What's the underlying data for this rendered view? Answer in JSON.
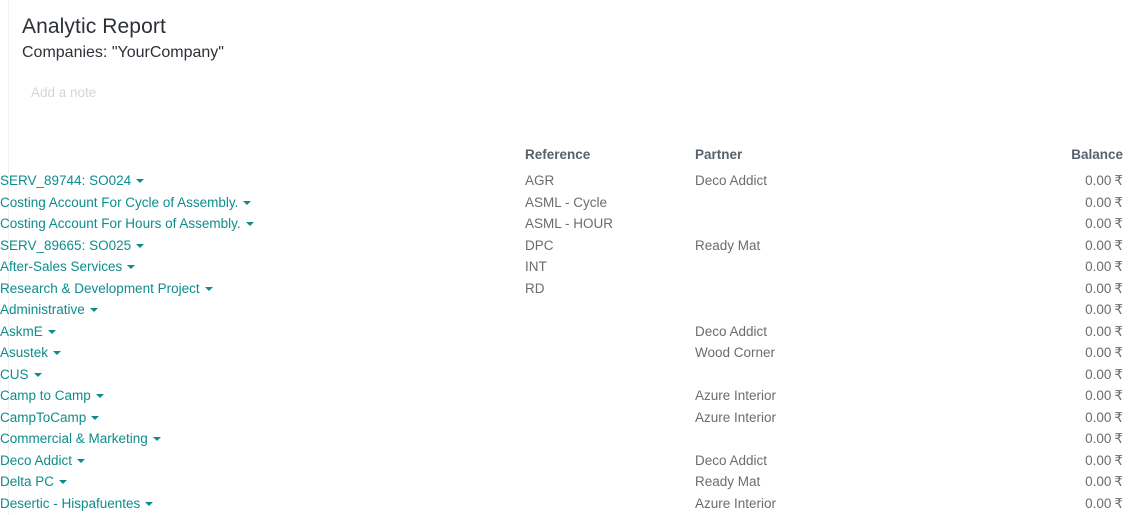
{
  "report": {
    "title": "Analytic Report",
    "subtitle": "Companies: \"YourCompany\"",
    "note_placeholder": "Add a note"
  },
  "colors": {
    "link_teal": "#0e8c8c",
    "header_gray": "#58626d",
    "body_gray": "#6c6c6c",
    "title_dark": "#2c3137",
    "placeholder_gray": "#d5d5d5"
  },
  "table": {
    "columns": {
      "name": "",
      "reference": "Reference",
      "partner": "Partner",
      "balance": "Balance"
    },
    "currency_symbol": "₹",
    "rows": [
      {
        "name": "SERV_89744: SO024",
        "reference": "AGR",
        "partner": "Deco Addict",
        "balance": "0.00"
      },
      {
        "name": "Costing Account For Cycle of Assembly.",
        "reference": "ASML - Cycle",
        "partner": "",
        "balance": "0.00"
      },
      {
        "name": "Costing Account For Hours of Assembly.",
        "reference": "ASML - HOUR",
        "partner": "",
        "balance": "0.00"
      },
      {
        "name": "SERV_89665: SO025",
        "reference": "DPC",
        "partner": "Ready Mat",
        "balance": "0.00"
      },
      {
        "name": "After-Sales Services",
        "reference": "INT",
        "partner": "",
        "balance": "0.00"
      },
      {
        "name": "Research & Development Project",
        "reference": "RD",
        "partner": "",
        "balance": "0.00"
      },
      {
        "name": "Administrative",
        "reference": "",
        "partner": "",
        "balance": "0.00"
      },
      {
        "name": "AskmE",
        "reference": "",
        "partner": "Deco Addict",
        "balance": "0.00"
      },
      {
        "name": "Asustek",
        "reference": "",
        "partner": "Wood Corner",
        "balance": "0.00"
      },
      {
        "name": "CUS",
        "reference": "",
        "partner": "",
        "balance": "0.00"
      },
      {
        "name": "Camp to Camp",
        "reference": "",
        "partner": "Azure Interior",
        "balance": "0.00"
      },
      {
        "name": "CampToCamp",
        "reference": "",
        "partner": "Azure Interior",
        "balance": "0.00"
      },
      {
        "name": "Commercial & Marketing",
        "reference": "",
        "partner": "",
        "balance": "0.00"
      },
      {
        "name": "Deco Addict",
        "reference": "",
        "partner": "Deco Addict",
        "balance": "0.00"
      },
      {
        "name": "Delta PC",
        "reference": "",
        "partner": "Ready Mat",
        "balance": "0.00"
      },
      {
        "name": "Desertic - Hispafuentes",
        "reference": "",
        "partner": "Azure Interior",
        "balance": "0.00"
      }
    ]
  }
}
